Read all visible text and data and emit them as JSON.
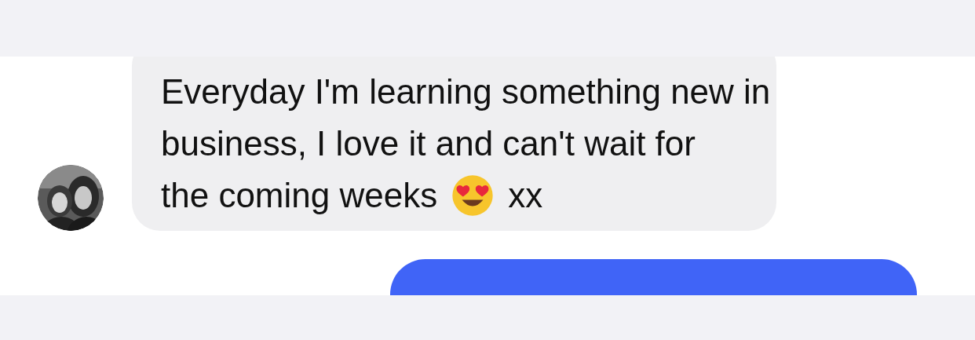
{
  "messages": [
    {
      "kind": "received",
      "text": "Everyday I'm learning something new in business, I love it and can't wait for",
      "last_line": "the coming weeks",
      "trailing": "xx"
    },
    {
      "kind": "sent"
    }
  ]
}
